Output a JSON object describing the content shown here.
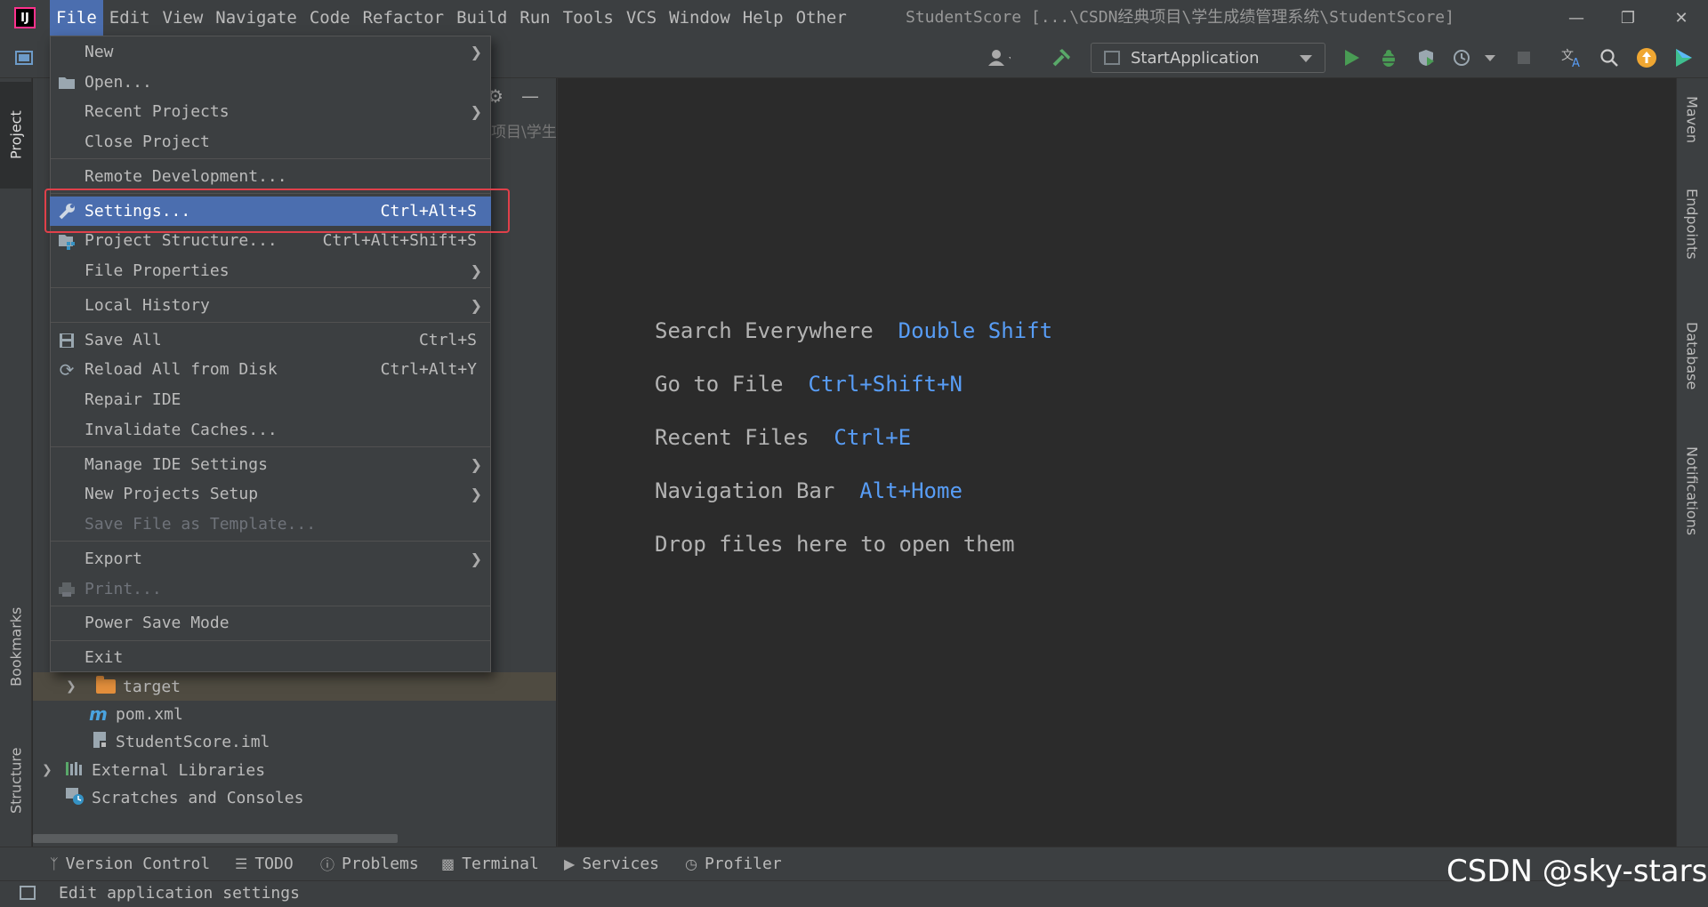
{
  "menubar": {
    "items": [
      "File",
      "Edit",
      "View",
      "Navigate",
      "Code",
      "Refactor",
      "Build",
      "Run",
      "Tools",
      "VCS",
      "Window",
      "Help",
      "Other"
    ],
    "active_index": 0,
    "window_title": "StudentScore [...\\CSDN经典项目\\学生成绩管理系统\\StudentScore]"
  },
  "toolbar": {
    "run_config": "StartApplication"
  },
  "left_stripe": {
    "project": "Project",
    "bookmarks": "Bookmarks",
    "structure": "Structure"
  },
  "right_stripe": {
    "maven": "Maven",
    "endpoints": "Endpoints",
    "database": "Database",
    "notifications": "Notifications"
  },
  "project_tree": {
    "partial_path": "项目\\学生(",
    "items": [
      {
        "label": "target",
        "icon": "folder-icon"
      },
      {
        "label": "pom.xml",
        "icon": "maven-icon"
      },
      {
        "label": "StudentScore.iml",
        "icon": "iml-file-icon"
      },
      {
        "label": "External Libraries",
        "icon": "libraries-icon"
      },
      {
        "label": "Scratches and Consoles",
        "icon": "scratches-icon"
      }
    ]
  },
  "file_menu": {
    "items": [
      {
        "label": "New",
        "shortcut": "",
        "submenu": true
      },
      {
        "label": "Open...",
        "shortcut": "",
        "submenu": false
      },
      {
        "label": "Recent Projects",
        "shortcut": "",
        "submenu": true
      },
      {
        "label": "Close Project",
        "shortcut": "",
        "submenu": false
      },
      {
        "label": "Remote Development...",
        "shortcut": "",
        "submenu": false
      },
      {
        "label": "Settings...",
        "shortcut": "Ctrl+Alt+S",
        "submenu": false
      },
      {
        "label": "Project Structure...",
        "shortcut": "Ctrl+Alt+Shift+S",
        "submenu": false
      },
      {
        "label": "File Properties",
        "shortcut": "",
        "submenu": true
      },
      {
        "label": "Local History",
        "shortcut": "",
        "submenu": true
      },
      {
        "label": "Save All",
        "shortcut": "Ctrl+S",
        "submenu": false
      },
      {
        "label": "Reload All from Disk",
        "shortcut": "Ctrl+Alt+Y",
        "submenu": false
      },
      {
        "label": "Repair IDE",
        "shortcut": "",
        "submenu": false
      },
      {
        "label": "Invalidate Caches...",
        "shortcut": "",
        "submenu": false
      },
      {
        "label": "Manage IDE Settings",
        "shortcut": "",
        "submenu": true
      },
      {
        "label": "New Projects Setup",
        "shortcut": "",
        "submenu": true
      },
      {
        "label": "Save File as Template...",
        "shortcut": "",
        "submenu": false
      },
      {
        "label": "Export",
        "shortcut": "",
        "submenu": true
      },
      {
        "label": "Print...",
        "shortcut": "",
        "submenu": false
      },
      {
        "label": "Power Save Mode",
        "shortcut": "",
        "submenu": false
      },
      {
        "label": "Exit",
        "shortcut": "",
        "submenu": false
      }
    ],
    "highlighted": "Settings...",
    "disabled": [
      "Save File as Template...",
      "Print..."
    ]
  },
  "editor": {
    "hints": [
      {
        "label": "Search Everywhere",
        "shortcut": "Double Shift"
      },
      {
        "label": "Go to File",
        "shortcut": "Ctrl+Shift+N"
      },
      {
        "label": "Recent Files",
        "shortcut": "Ctrl+E"
      },
      {
        "label": "Navigation Bar",
        "shortcut": "Alt+Home"
      },
      {
        "label": "Drop files here to open them",
        "shortcut": ""
      }
    ]
  },
  "bottom_tools": [
    "Version Control",
    "TODO",
    "Problems",
    "Terminal",
    "Services",
    "Profiler"
  ],
  "status": {
    "text": "Edit application settings"
  },
  "watermark": "CSDN @sky-stars",
  "colors": {
    "highlight": "#4b6eaf",
    "shortcut_blue": "#589df6",
    "annotation_red": "#e0404a",
    "folder_orange": "#e38f3c"
  }
}
